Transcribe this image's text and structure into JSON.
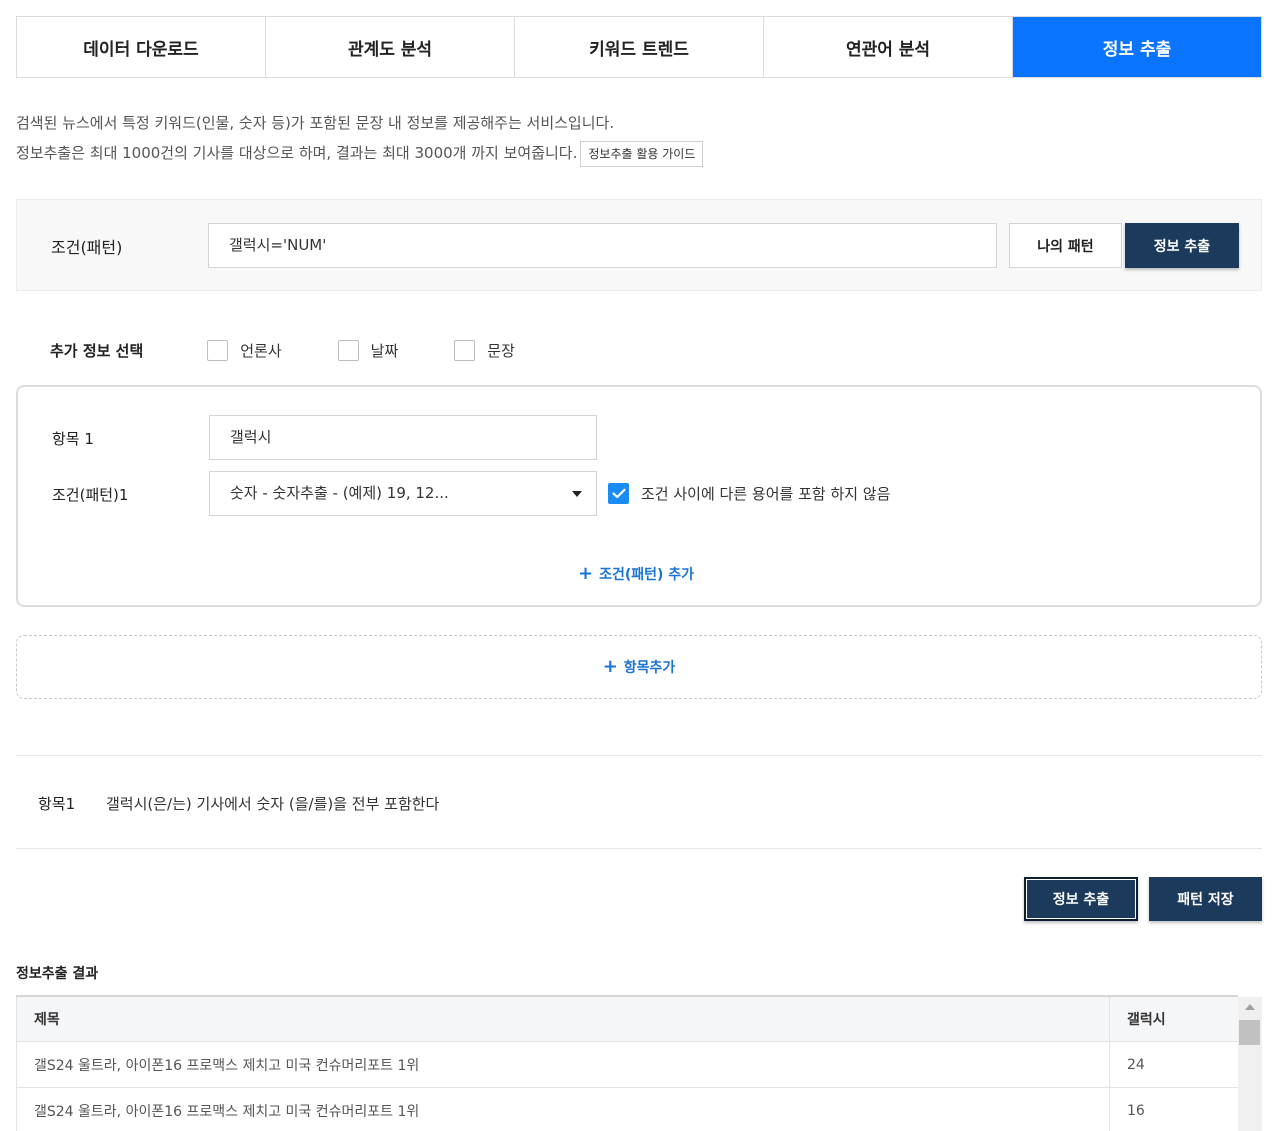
{
  "tabs": [
    {
      "label": "데이터 다운로드",
      "active": false
    },
    {
      "label": "관계도 분석",
      "active": false
    },
    {
      "label": "키워드 트렌드",
      "active": false
    },
    {
      "label": "연관어 분석",
      "active": false
    },
    {
      "label": "정보 추출",
      "active": true
    }
  ],
  "intro": {
    "line1": "검색된 뉴스에서 특정 키워드(인물, 숫자 등)가 포함된 문장 내 정보를 제공해주는 서비스입니다.",
    "line2": "정보추출은 최대 1000건의 기사를 대상으로 하며, 결과는 최대 3000개 까지 보여줍니다.",
    "guide_button": "정보추출 활용 가이드"
  },
  "pattern": {
    "label": "조건(패턴)",
    "value": "갤럭시='NUM'",
    "my_pattern_button": "나의 패턴",
    "extract_button": "정보 추출"
  },
  "extra": {
    "title": "추가 정보 선택",
    "options": [
      {
        "label": "언론사",
        "checked": false
      },
      {
        "label": "날짜",
        "checked": false
      },
      {
        "label": "문장",
        "checked": false
      }
    ]
  },
  "item": {
    "item_label": "항목 1",
    "item_value": "갤럭시",
    "condition_label": "조건(패턴)1",
    "condition_value": "숫자 - 숫자추출 - (예제) 19, 12...",
    "no_other_terms_label": "조건 사이에 다른 용어를 포함 하지 않음",
    "no_other_terms_checked": true,
    "add_condition": "조건(패턴) 추가"
  },
  "add_item": "항목추가",
  "summary": {
    "label": "항목1",
    "text": "갤럭시(은/는) 기사에서 숫자 (을/를)을 전부 포함한다"
  },
  "actions": {
    "extract": "정보 추출",
    "save_pattern": "패턴 저장"
  },
  "results": {
    "title": "정보추출 결과",
    "columns": [
      "제목",
      "갤럭시"
    ],
    "rows": [
      [
        "갤S24 울트라, 아이폰16 프로맥스 제치고 미국 컨슈머리포트 1위",
        "24"
      ],
      [
        "갤S24 울트라, 아이폰16 프로맥스 제치고 미국 컨슈머리포트 1위",
        "16"
      ]
    ]
  },
  "colors": {
    "active_tab": "#0a74ff",
    "navy_button": "#1b3a5c",
    "link_blue": "#1a74d4",
    "checkbox_blue": "#1a8cf5"
  }
}
